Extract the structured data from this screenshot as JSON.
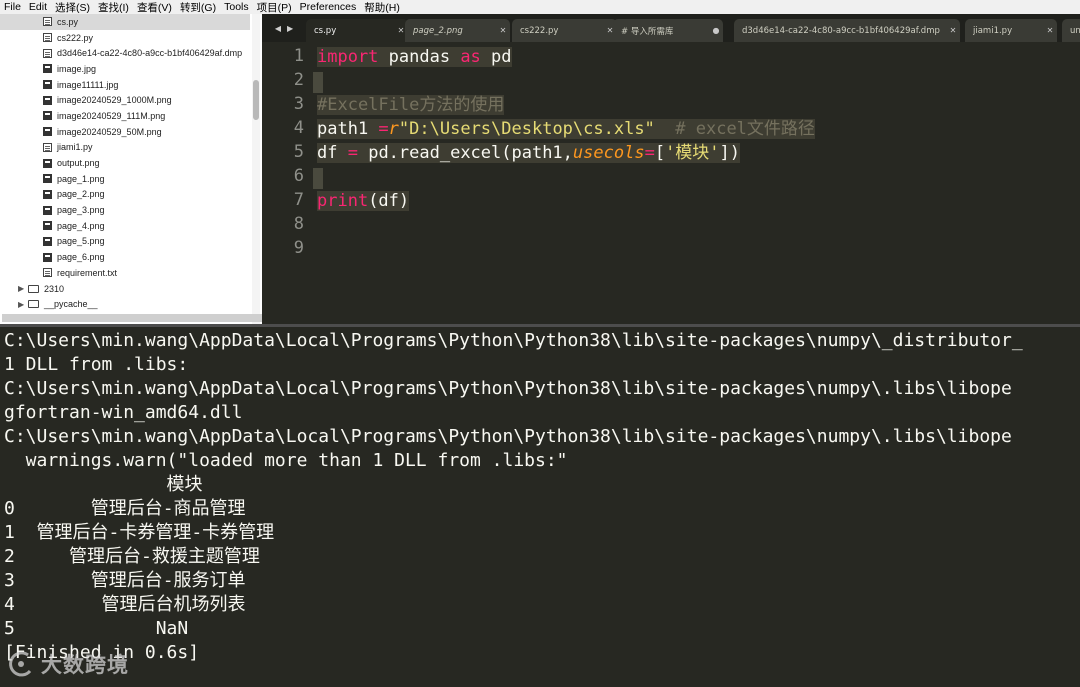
{
  "menu": [
    "File",
    "Edit",
    "选择(S)",
    "查找(I)",
    "查看(V)",
    "转到(G)",
    "Tools",
    "项目(P)",
    "Preferences",
    "帮助(H)"
  ],
  "sidebar": {
    "files": [
      {
        "name": "cs.py",
        "icon": "file-icon",
        "selected": true
      },
      {
        "name": "cs222.py",
        "icon": "file-icon"
      },
      {
        "name": "d3d46e14-ca22-4c80-a9cc-b1bf406429af.dmp",
        "icon": "file-icon"
      },
      {
        "name": "image.jpg",
        "icon": "image-icon"
      },
      {
        "name": "image11111.jpg",
        "icon": "image-icon"
      },
      {
        "name": "image20240529_1000M.png",
        "icon": "image-icon"
      },
      {
        "name": "image20240529_111M.png",
        "icon": "image-icon"
      },
      {
        "name": "image20240529_50M.png",
        "icon": "image-icon"
      },
      {
        "name": "jiami1.py",
        "icon": "file-icon"
      },
      {
        "name": "output.png",
        "icon": "image-icon"
      },
      {
        "name": "page_1.png",
        "icon": "image-icon"
      },
      {
        "name": "page_2.png",
        "icon": "image-icon"
      },
      {
        "name": "page_3.png",
        "icon": "image-icon"
      },
      {
        "name": "page_4.png",
        "icon": "image-icon"
      },
      {
        "name": "page_5.png",
        "icon": "image-icon"
      },
      {
        "name": "page_6.png",
        "icon": "image-icon"
      },
      {
        "name": "requirement.txt",
        "icon": "file-icon"
      }
    ],
    "folders": [
      "2310",
      "__pycache__"
    ]
  },
  "tabs": [
    {
      "label": "cs.py",
      "active": true
    },
    {
      "label": "page_2.png",
      "italic": true
    },
    {
      "label": "cs222.py"
    },
    {
      "label": "# 导入所需库",
      "dirty": true
    },
    {
      "label": "d3d46e14-ca22-4c80-a9cc-b1bf406429af.dmp"
    },
    {
      "label": "jiami1.py"
    },
    {
      "label": "un"
    }
  ],
  "editor": {
    "line_numbers": [
      "1",
      "2",
      "3",
      "4",
      "5",
      "6",
      "7",
      "8",
      "9"
    ],
    "code": {
      "l1_kw1": "import",
      "l1_mod": " pandas ",
      "l1_kw2": "as",
      "l1_alias": " pd",
      "l3_comment": "#ExcelFile方法的使用",
      "l4_var": "path1 ",
      "l4_eq": "=",
      "l4_prefix": "r",
      "l4_str": "\"D:\\Users\\Desktop\\cs.xls\"",
      "l4_comment": "  # excel文件路径",
      "l5_var": "df ",
      "l5_eq": "=",
      "l5_call": " pd.read_excel(path1,",
      "l5_arg": "usecols",
      "l5_eq2": "=",
      "l5_open": "[",
      "l5_str": "'模块'",
      "l5_close": "])",
      "l7_fn": "print",
      "l7_rest": "(df)"
    }
  },
  "console": {
    "lines": [
      "C:\\Users\\min.wang\\AppData\\Local\\Programs\\Python\\Python38\\lib\\site-packages\\numpy\\_distributor_",
      "1 DLL from .libs:",
      "C:\\Users\\min.wang\\AppData\\Local\\Programs\\Python\\Python38\\lib\\site-packages\\numpy\\.libs\\libope",
      "gfortran-win_amd64.dll",
      "C:\\Users\\min.wang\\AppData\\Local\\Programs\\Python\\Python38\\lib\\site-packages\\numpy\\.libs\\libope",
      "  warnings.warn(\"loaded more than 1 DLL from .libs:\"",
      "               模块",
      "0       管理后台-商品管理",
      "1  管理后台-卡券管理-卡券管理",
      "2     管理后台-救援主题管理",
      "3       管理后台-服务订单",
      "4        管理后台机场列表",
      "5             NaN",
      "[Finished in 0.6s]"
    ]
  },
  "watermark": {
    "text": "大数跨境"
  }
}
